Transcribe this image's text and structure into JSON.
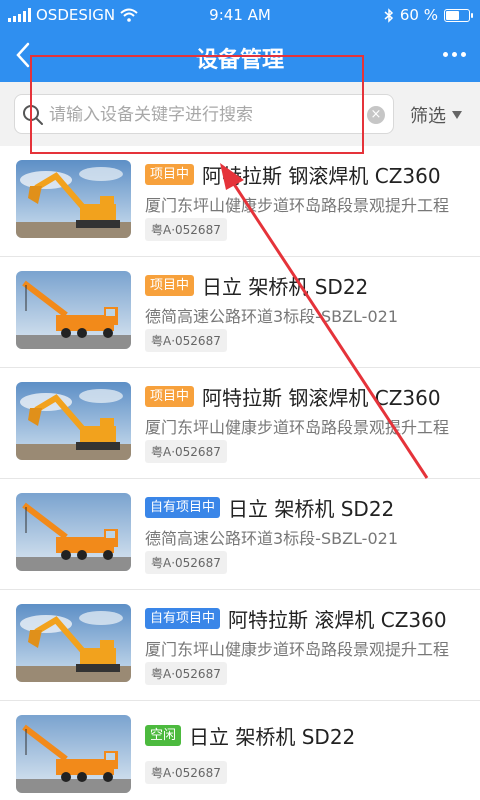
{
  "status_bar": {
    "carrier": "OSDESIGN",
    "time": "9:41 AM",
    "battery": "60 %",
    "battery_level": 0.6
  },
  "nav": {
    "back_icon": "chevron-left-icon",
    "title": "设备管理",
    "more_icon": "more-dots-icon"
  },
  "search": {
    "placeholder": "请输入设备关键字进行搜索",
    "value": "",
    "filter_label": "筛选"
  },
  "colors": {
    "primary": "#2f8ff0",
    "tag_in_project": "#f7a13c",
    "tag_own_project": "#3a86e8",
    "tag_idle": "#4cba3e",
    "annotation": "#e5333a"
  },
  "equipment": [
    {
      "tag": "项目中",
      "tag_type": "in_project",
      "name": "阿特拉斯 钢滚焊机 CZ360",
      "location": "厦门东坪山健康步道环岛路段景观提升工程",
      "plate": "粤A·052687",
      "image": "excavator"
    },
    {
      "tag": "项目中",
      "tag_type": "in_project",
      "name": "日立 架桥机 SD22",
      "location": "德简高速公路环道3标段-SBZL-021",
      "plate": "粤A·052687",
      "image": "crane-truck"
    },
    {
      "tag": "项目中",
      "tag_type": "in_project",
      "name": "阿特拉斯 钢滚焊机 CZ360",
      "location": "厦门东坪山健康步道环岛路段景观提升工程",
      "plate": "粤A·052687",
      "image": "excavator"
    },
    {
      "tag": "自有项目中",
      "tag_type": "own_project",
      "name": "日立 架桥机 SD22",
      "location": "德简高速公路环道3标段-SBZL-021",
      "plate": "粤A·052687",
      "image": "crane-truck"
    },
    {
      "tag": "自有项目中",
      "tag_type": "own_project",
      "name": "阿特拉斯 滚焊机 CZ360",
      "location": "厦门东坪山健康步道环岛路段景观提升工程",
      "plate": "粤A·052687",
      "image": "excavator"
    },
    {
      "tag": "空闲",
      "tag_type": "idle",
      "name": "日立 架桥机 SD22",
      "location": "",
      "plate": "粤A·052687",
      "image": "crane-truck"
    }
  ]
}
